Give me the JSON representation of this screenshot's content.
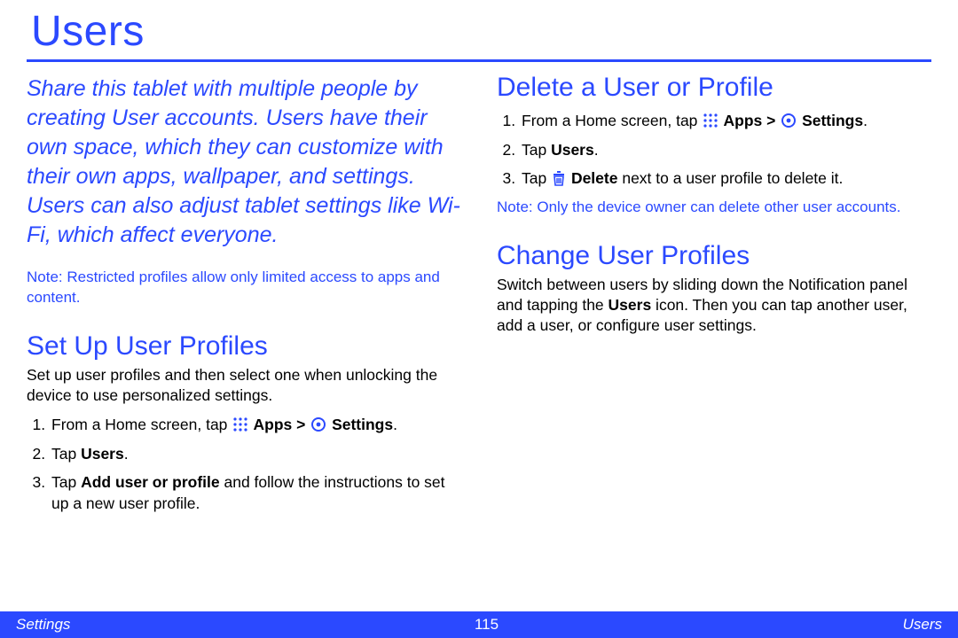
{
  "title": "Users",
  "intro": "Share this tablet with multiple people by creating User accounts. Users have their own space, which they can customize with their own apps, wallpaper, and settings. Users can also adjust tablet settings like Wi-Fi, which affect everyone.",
  "left_note_label": "Note",
  "left_note_text": ": Restricted profiles allow only limited access to apps and content.",
  "setup": {
    "heading": "Set Up User Profiles",
    "intro": "Set up user profiles and then select one when unlocking the device to use personalized settings.",
    "step1_pre": "From a Home screen, tap ",
    "step1_apps": " Apps > ",
    "step1_settings": " Settings",
    "step1_post": ".",
    "step2_pre": "Tap ",
    "step2_bold": "Users",
    "step2_post": ".",
    "step3_pre": "Tap ",
    "step3_bold": "Add user or profile",
    "step3_post": " and follow the instructions to set up a new user profile."
  },
  "delete": {
    "heading": "Delete a User or Profile",
    "step1_pre": "From a Home screen, tap ",
    "step1_apps": " Apps > ",
    "step1_settings": " Settings",
    "step1_post": ".",
    "step2_pre": "Tap ",
    "step2_bold": "Users",
    "step2_post": ".",
    "step3_pre": "Tap ",
    "step3_bold": " Delete",
    "step3_post": " next to a user profile to delete it.",
    "note_label": "Note",
    "note_text": ": Only the device owner can delete other user accounts."
  },
  "change": {
    "heading": "Change User Profiles",
    "text_a": "Switch between users by sliding down the Notification panel and tapping the ",
    "text_bold": "Users",
    "text_b": " icon. Then you can tap another user, add a user, or configure user settings."
  },
  "footer": {
    "left": "Settings",
    "page": "115",
    "right": "Users"
  }
}
